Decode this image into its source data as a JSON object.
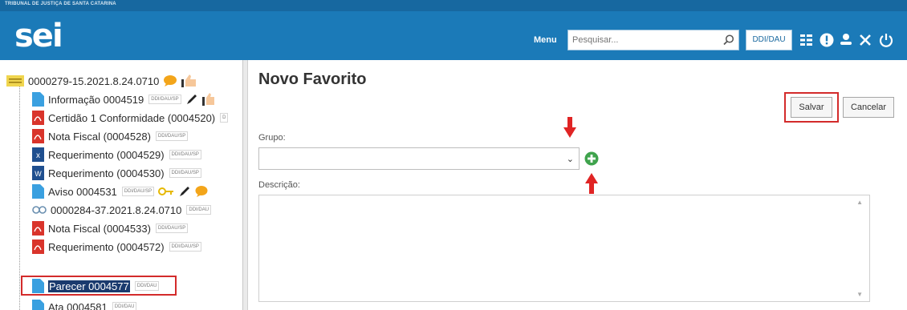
{
  "header": {
    "org_name": "TRIBUNAL DE JUSTIÇA DE SANTA CATARINA",
    "logo_text": "sei",
    "menu_label": "Menu",
    "search_placeholder": "Pesquisar...",
    "unit": "DDI/DAU",
    "icons": [
      "grid-icon",
      "info-icon",
      "user-icon",
      "tools-icon",
      "power-icon"
    ]
  },
  "tree": {
    "process": "0000279-15.2021.8.24.0710",
    "items": [
      {
        "label": "Informação 0004519",
        "tag": "DDI/DAU/SP",
        "icon": "doc-icon"
      },
      {
        "label": "Certidão 1 Conformidade (0004520)",
        "tag": "D",
        "icon": "pdf-icon"
      },
      {
        "label": "Nota Fiscal (0004528)",
        "tag": "DDI/DAU/SP",
        "icon": "pdf-icon"
      },
      {
        "label": "Requerimento (0004529)",
        "tag": "DDI/DAU/SP",
        "icon": "excel-icon"
      },
      {
        "label": "Requerimento (0004530)",
        "tag": "DDI/DAU/SP",
        "icon": "word-icon"
      },
      {
        "label": "Aviso 0004531",
        "tag": "DDI/DAU/SP",
        "icon": "doc-icon"
      },
      {
        "label": "0000284-37.2021.8.24.0710",
        "tag": "DDI/DAU",
        "icon": "link-icon"
      },
      {
        "label": "Nota Fiscal (0004533)",
        "tag": "DDI/DAU/SP",
        "icon": "pdf-icon"
      },
      {
        "label": "Requerimento (0004572)",
        "tag": "DDI/DAU/SP",
        "icon": "pdf-icon"
      },
      {
        "label": "Parecer 0004577",
        "tag": "DDI/DAU",
        "icon": "doc-icon",
        "selected": true
      },
      {
        "label": "Ata 0004581",
        "tag": "DDI/DAU",
        "icon": "doc-icon"
      }
    ]
  },
  "form": {
    "title": "Novo Favorito",
    "save_label": "Salvar",
    "cancel_label": "Cancelar",
    "group_label": "Grupo:",
    "group_value": "",
    "description_label": "Descrição:",
    "description_value": ""
  },
  "colors": {
    "header_blue": "#1b7ab8",
    "highlight_red": "#d32b2b",
    "add_green": "#3fa34d",
    "selected_bg": "#1a3a6e"
  }
}
